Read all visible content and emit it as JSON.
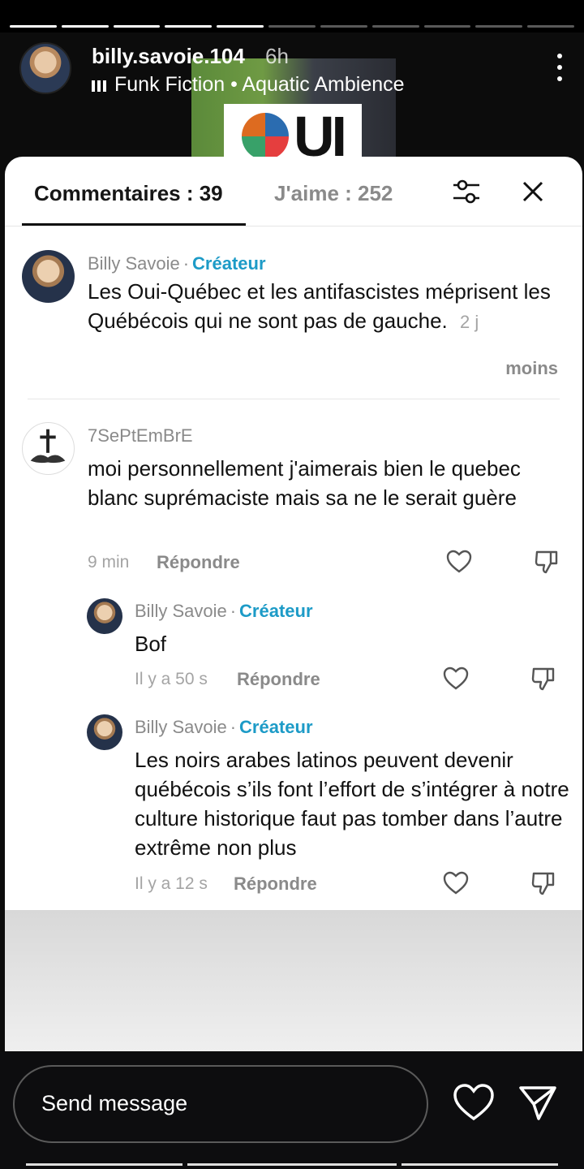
{
  "story": {
    "username": "billy.savoie.104",
    "time_ago": "6h",
    "music": "Funk Fiction • Aquatic Ambience",
    "image_text": "UI",
    "progress_segments": 11,
    "progress_filled": 5
  },
  "comments_panel": {
    "tab_comments": "Commentaires : 39",
    "tab_likes": "J'aime : 252",
    "more_label": "moins",
    "comments": [
      {
        "author": "Billy Savoie",
        "badge": "Créateur",
        "text": "Les Oui-Québec et les antifascistes méprisent les Québécois qui ne sont pas de gauche.",
        "time": "2 j"
      },
      {
        "author": "7SePtEmBrE",
        "text": "moi personnellement j'aimerais bien le quebec blanc suprémaciste mais sa ne le serait guère",
        "time": "9 min",
        "reply_label": "Répondre",
        "replies": [
          {
            "author": "Billy Savoie",
            "badge": "Créateur",
            "text": "Bof",
            "time": "Il y a 50 s",
            "reply_label": "Répondre"
          },
          {
            "author": "Billy Savoie",
            "badge": "Créateur",
            "text": "Les noirs arabes latinos peuvent devenir québécois s’ils font l’effort de s’intégrer à notre culture historique faut pas tomber dans l’autre extrême non plus",
            "time": "Il y a 12 s",
            "reply_label": "Répondre"
          }
        ]
      }
    ]
  },
  "bottom_bar": {
    "send_placeholder": "Send message"
  },
  "colors": {
    "creator_badge": "#1d9bc7",
    "panel_bg": "#ffffff",
    "story_bg": "#000000"
  }
}
